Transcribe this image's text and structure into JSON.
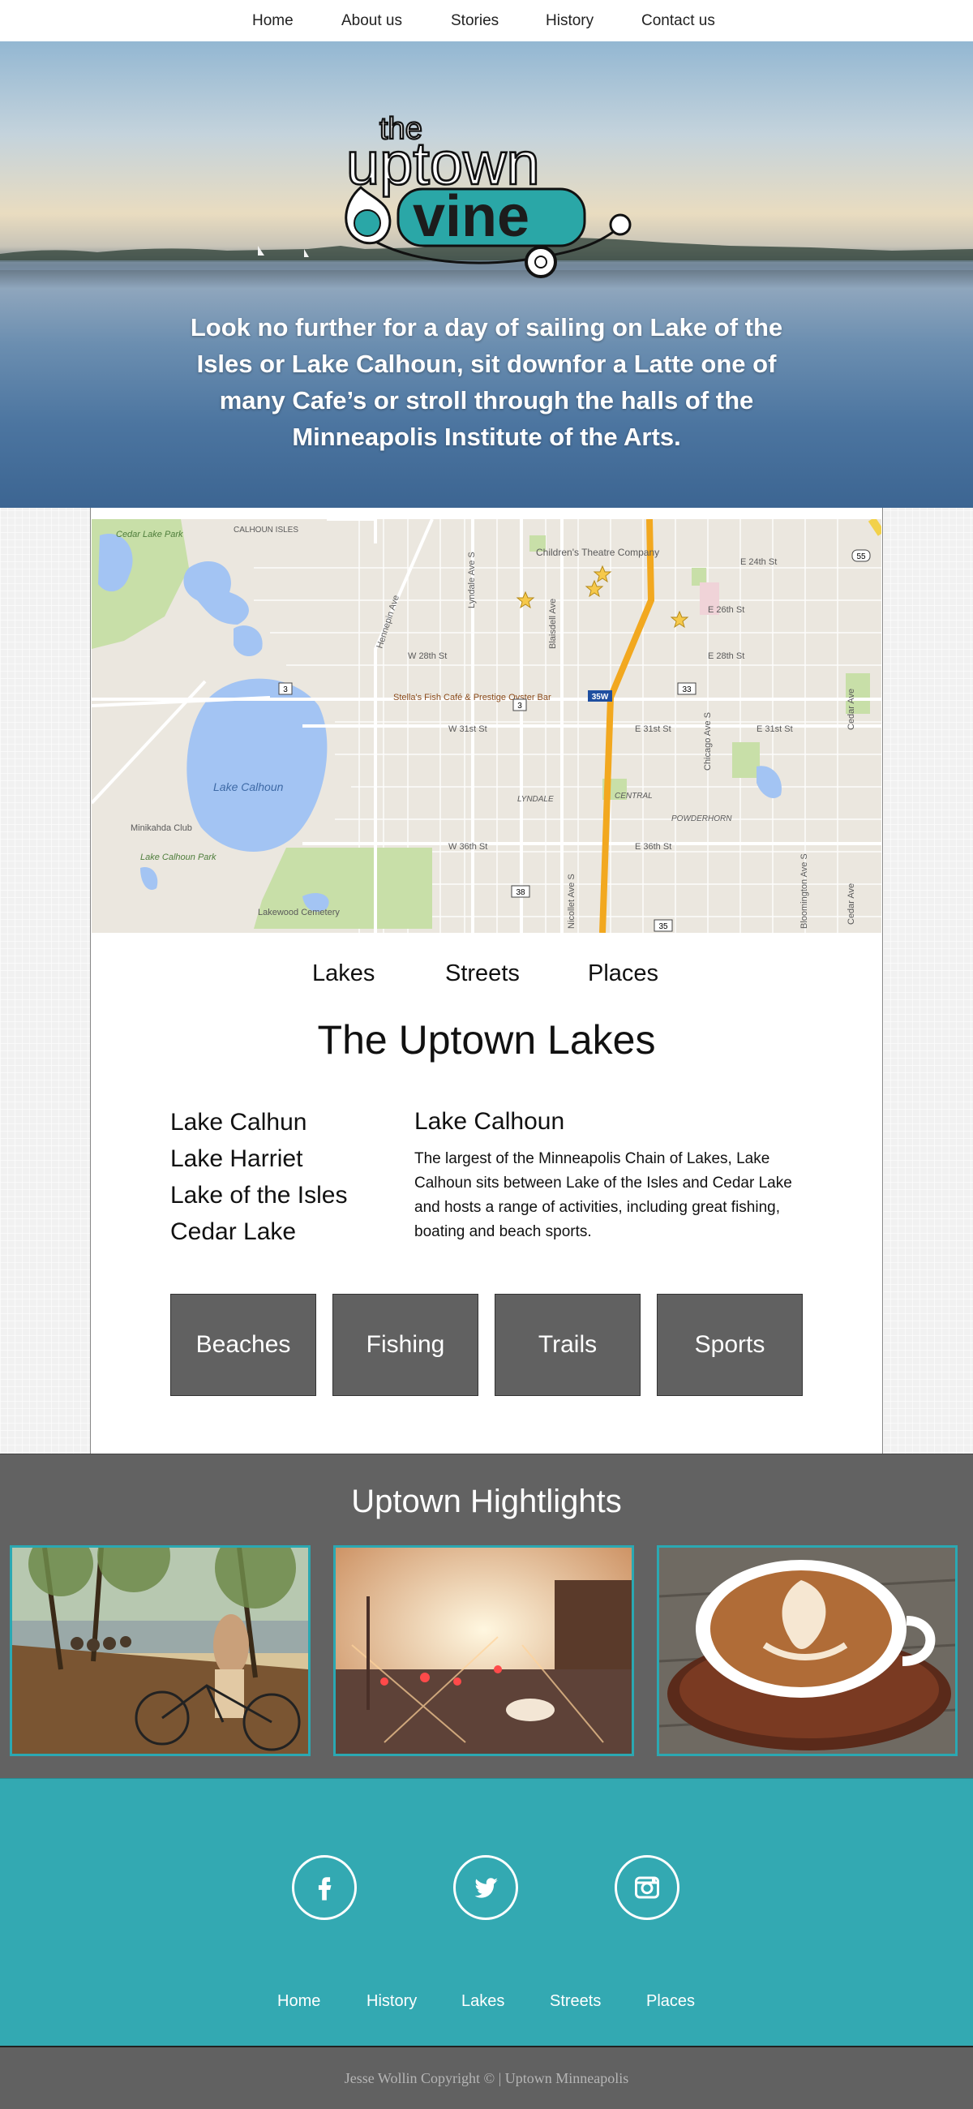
{
  "topnav": {
    "items": [
      "Home",
      "About us",
      "Stories",
      "History",
      "Contact us"
    ]
  },
  "hero": {
    "logo": {
      "line1": "the",
      "line2": "uptown",
      "line3": "vine"
    },
    "tagline": "Look no further for a day of sailing on Lake of the Isles or Lake Calhoun, sit downfor a Latte one of many Cafe’s or stroll through the halls of the Minneapolis Institute of the Arts."
  },
  "map": {
    "labels": {
      "cedar_lake_park": "Cedar Lake Park",
      "calhoun_isles": "CALHOUN ISLES",
      "childrens_theatre": "Children's Theatre Company",
      "lake_calhoun": "Lake Calhoun",
      "stellas": "Stella's Fish Café & Prestige Oyster Bar",
      "minikahda": "Minikahda Club",
      "lake_calhoun_park": "Lake Calhoun Park",
      "lakewood": "Lakewood Cemetery",
      "lyndale": "LYNDALE",
      "central": "CENTRAL",
      "powderhorn": "POWDERHORN",
      "w28": "W 28th St",
      "w31": "W 31st St",
      "w36": "W 36th St",
      "e24": "E 24th St",
      "e26": "E 26th St",
      "e28": "E 28th St",
      "e31": "E 31st St",
      "e36": "E 36th St",
      "hennepin": "Hennepin Ave",
      "lyndale_ave": "Lyndale Ave S",
      "blaisdell": "Blaisdell Ave",
      "nicollet": "Nicollet Ave S",
      "chicago": "Chicago Ave S",
      "bloomington": "Bloomington Ave S",
      "cedar_ave": "Cedar Ave",
      "shield_35w": "35W",
      "route_3a": "3",
      "route_3b": "3",
      "route_33": "33",
      "route_38": "38",
      "route_35": "35",
      "route_55": "55"
    }
  },
  "subnav": {
    "items": [
      "Lakes",
      "Streets",
      "Places"
    ]
  },
  "section": {
    "title": "The Uptown Lakes",
    "lakes": [
      "Lake Calhun",
      "Lake Harriet",
      "Lake of the Isles",
      "Cedar Lake"
    ],
    "detail_title": "Lake Calhoun",
    "detail_text": "The largest of the Minneapolis Chain of Lakes, Lake Calhoun sits between Lake of the Isles and Cedar Lake and hosts a range of activities, including great fishing, boating and beach sports."
  },
  "activities": [
    "Beaches",
    "Fishing",
    "Trails",
    "Sports"
  ],
  "highlights": {
    "title": "Uptown Hightlights"
  },
  "social": {
    "icons": [
      "facebook-icon",
      "twitter-icon",
      "instagram-icon"
    ]
  },
  "footer": {
    "nav": [
      "Home",
      "History",
      "Lakes",
      "Streets",
      "Places"
    ],
    "copyright": "Jesse Wollin Copyright ©  |  Uptown Minneapolis"
  },
  "colors": {
    "teal": "#33a9b2",
    "dark_gray": "#616161",
    "tile_gray": "#616161"
  }
}
